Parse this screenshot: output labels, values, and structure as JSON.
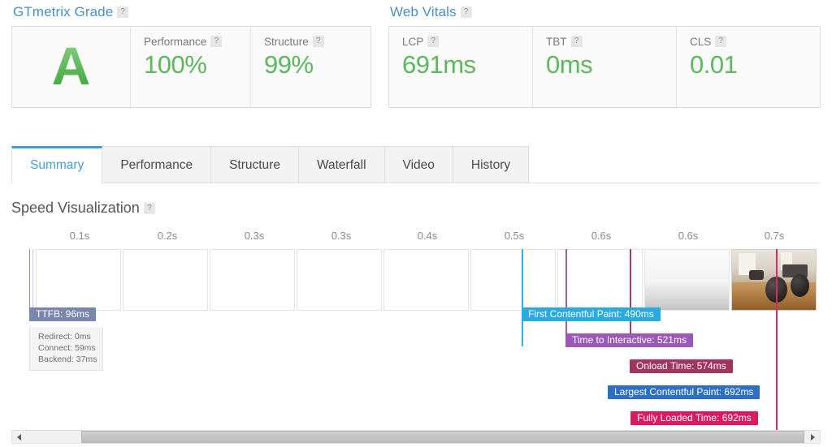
{
  "grade_section": {
    "title": "GTmetrix Grade",
    "help_glyph": "?",
    "grade_letter": "A",
    "metrics": [
      {
        "label": "Performance",
        "value": "100%"
      },
      {
        "label": "Structure",
        "value": "99%"
      }
    ]
  },
  "vitals_section": {
    "title": "Web Vitals",
    "help_glyph": "?",
    "metrics": [
      {
        "label": "LCP",
        "value": "691ms"
      },
      {
        "label": "TBT",
        "value": "0ms"
      },
      {
        "label": "CLS",
        "value": "0.01"
      }
    ]
  },
  "tabs": [
    {
      "label": "Summary",
      "active": true
    },
    {
      "label": "Performance",
      "active": false
    },
    {
      "label": "Structure",
      "active": false
    },
    {
      "label": "Waterfall",
      "active": false
    },
    {
      "label": "Video",
      "active": false
    },
    {
      "label": "History",
      "active": false
    }
  ],
  "speed_visualization": {
    "title": "Speed Visualization",
    "help_glyph": "?",
    "axis_ticks": [
      "0.1s",
      "0.2s",
      "0.3s",
      "0.3s",
      "0.4s",
      "0.5s",
      "0.6s",
      "0.6s",
      "0.7s"
    ],
    "events": [
      {
        "key": "ttfb",
        "label": "TTFB: 96ms",
        "color": "#7986ad"
      },
      {
        "key": "fcp",
        "label": "First Contentful Paint: 490ms",
        "color": "#29abe2"
      },
      {
        "key": "tti",
        "label": "Time to Interactive: 521ms",
        "color": "#9b59b6"
      },
      {
        "key": "onload",
        "label": "Onload Time: 574ms",
        "color": "#a0355f"
      },
      {
        "key": "lcp",
        "label": "Largest Contentful Paint: 692ms",
        "color": "#2e6fc4"
      },
      {
        "key": "fl",
        "label": "Fully Loaded Time: 692ms",
        "color": "#d81b60"
      }
    ],
    "ttfb_breakdown": [
      "Redirect: 0ms",
      "Connect: 59ms",
      "Backend: 37ms"
    ]
  },
  "chart_data": {
    "type": "timeline",
    "title": "Speed Visualization",
    "xlabel": "",
    "ylabel": "",
    "xlim": [
      0,
      0.72
    ],
    "x_unit": "s",
    "axis_tick_labels": [
      "0.1s",
      "0.2s",
      "0.3s",
      "0.3s",
      "0.4s",
      "0.5s",
      "0.6s",
      "0.6s",
      "0.7s"
    ],
    "frames": 9,
    "frame_states": [
      "blank",
      "blank",
      "blank",
      "blank",
      "blank",
      "blank",
      "blank",
      "partial",
      "rendered"
    ],
    "markers": [
      {
        "name": "TTFB",
        "value_ms": 96,
        "color": "#7986ad"
      },
      {
        "name": "First Contentful Paint",
        "value_ms": 490,
        "color": "#29abe2"
      },
      {
        "name": "Time to Interactive",
        "value_ms": 521,
        "color": "#9b59b6"
      },
      {
        "name": "Onload Time",
        "value_ms": 574,
        "color": "#a0355f"
      },
      {
        "name": "Largest Contentful Paint",
        "value_ms": 692,
        "color": "#2e6fc4"
      },
      {
        "name": "Fully Loaded Time",
        "value_ms": 692,
        "color": "#d81b60"
      }
    ],
    "ttfb_components": [
      {
        "name": "Redirect",
        "value_ms": 0
      },
      {
        "name": "Connect",
        "value_ms": 59
      },
      {
        "name": "Backend",
        "value_ms": 37
      }
    ],
    "scores": {
      "gtmetrix_grade": "A",
      "performance_pct": 100,
      "structure_pct": 99,
      "lcp_ms": 691,
      "tbt_ms": 0,
      "cls": 0.01
    }
  }
}
